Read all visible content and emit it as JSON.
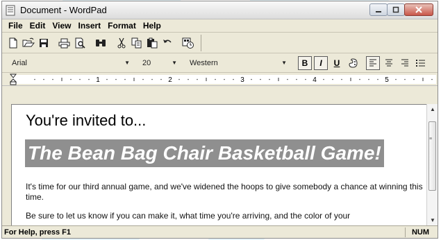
{
  "window": {
    "title": "Document - WordPad"
  },
  "menu": [
    "File",
    "Edit",
    "View",
    "Insert",
    "Format",
    "Help"
  ],
  "toolbar_icons": [
    "new-icon",
    "open-icon",
    "save-icon",
    "print-icon",
    "print-preview-icon",
    "find-icon",
    "cut-icon",
    "copy-icon",
    "paste-icon",
    "undo-icon",
    "insert-datetime-icon"
  ],
  "format": {
    "font": "Arial",
    "size": "20",
    "script": "Western",
    "bold_label": "B",
    "italic_label": "I",
    "underline_label": "U",
    "color_icon": "color-icon",
    "align_icons": [
      "align-left-icon",
      "align-center-icon",
      "align-right-icon",
      "bullets-icon"
    ]
  },
  "ruler": {
    "numbers": [
      "1",
      "2",
      "3",
      "4",
      "5"
    ]
  },
  "document": {
    "heading": "You're invited to...",
    "banner": "The Bean Bag Chair Basketball Game!",
    "paragraph": "It's time for our third annual game, and we've widened the hoops to give somebody a chance at winning this time.",
    "paragraph2": "Be sure to let us know if you can make it, what time you're arriving, and the color of your"
  },
  "status": {
    "help": "For Help, press F1",
    "num": "NUM"
  },
  "colors": {
    "banner_bg": "#8f8f8f",
    "chrome": "#ece9d8",
    "wave": "#cfe9f3"
  }
}
